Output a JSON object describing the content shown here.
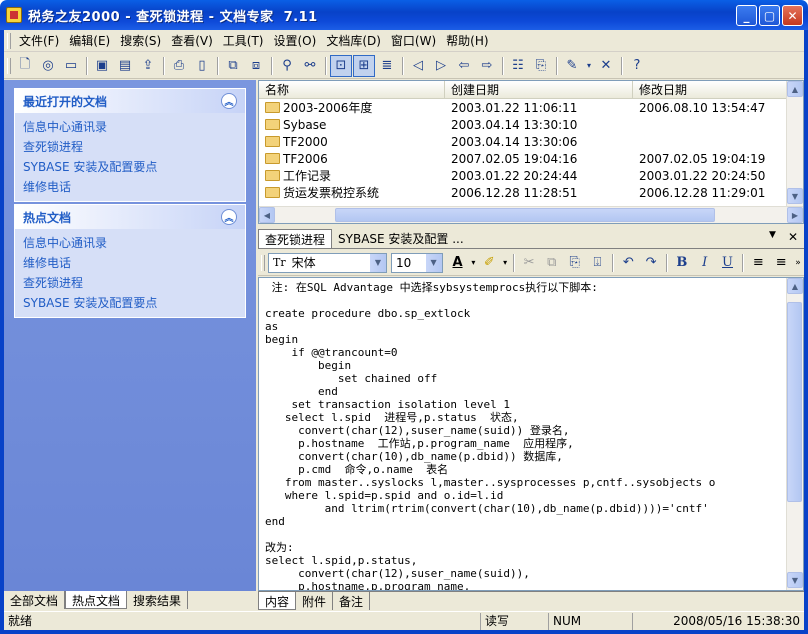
{
  "window": {
    "title": "税务之友2000 - 查死锁进程 - 文档专家  7.11"
  },
  "menu": [
    "文件(F)",
    "编辑(E)",
    "搜索(S)",
    "查看(V)",
    "工具(T)",
    "设置(O)",
    "文档库(D)",
    "窗口(W)",
    "帮助(H)"
  ],
  "toolbar": {
    "icons": [
      "new-doc",
      "open",
      "folder",
      "save",
      "save-all",
      "upload",
      "print",
      "print-preview",
      "copy-doc",
      "paste-doc",
      "find",
      "find-replace",
      "zoom-toggle",
      "zoom-fit",
      "export",
      "prev",
      "next",
      "back",
      "forward",
      "properties",
      "clipboard",
      "pen",
      "close-x",
      "help"
    ]
  },
  "sidebar": {
    "recent": {
      "title": "最近打开的文档",
      "items": [
        "信息中心通讯录",
        "查死锁进程",
        "SYBASE  安装及配置要点",
        "维修电话"
      ]
    },
    "hot": {
      "title": "热点文档",
      "items": [
        "信息中心通讯录",
        "维修电话",
        "查死锁进程",
        "SYBASE  安装及配置要点"
      ]
    },
    "tabs": [
      "全部文档",
      "热点文档",
      "搜索结果"
    ]
  },
  "filelist": {
    "columns": [
      "名称",
      "创建日期",
      "修改日期"
    ],
    "rows": [
      {
        "name": "2003-2006年度",
        "created": "2003.01.22 11:06:11",
        "modified": "2006.08.10 13:54:47"
      },
      {
        "name": "Sybase",
        "created": "2003.04.14 13:30:10",
        "modified": ""
      },
      {
        "name": "TF2000",
        "created": "2003.04.14 13:30:06",
        "modified": ""
      },
      {
        "name": "TF2006",
        "created": "2007.02.05 19:04:16",
        "modified": "2007.02.05 19:04:19"
      },
      {
        "name": "工作记录",
        "created": "2003.01.22 20:24:44",
        "modified": "2003.01.22 20:24:50"
      },
      {
        "name": "货运发票税控系统",
        "created": "2006.12.28 11:28:51",
        "modified": "2006.12.28 11:29:01"
      }
    ]
  },
  "doctabs": [
    "查死锁进程",
    "SYBASE  安装及配置 ..."
  ],
  "format": {
    "font": "宋体",
    "size": "10"
  },
  "editor": {
    "lines": [
      " 注: 在SQL Advantage 中选择sybsystemprocs执行以下脚本:",
      "",
      "create procedure dbo.sp_extlock",
      "as",
      "begin",
      "    if @@trancount=0",
      "        begin",
      "           set chained off",
      "        end",
      "    set transaction isolation level 1",
      "   select l.spid  进程号,p.status  状态,",
      "     convert(char(12),suser_name(suid)) 登录名,",
      "     p.hostname  工作站,p.program_name  应用程序,",
      "     convert(char(10),db_name(p.dbid)) 数据库,",
      "     p.cmd  命令,o.name  表名",
      "   from master..syslocks l,master..sysprocesses p,cntf..sysobjects o",
      "   where l.spid=p.spid and o.id=l.id",
      "         and ltrim(rtrim(convert(char(10),db_name(p.dbid))))='cntf'",
      "end",
      "",
      "改为:",
      "select l.spid,p.status,",
      "     convert(char(12),suser_name(suid)),",
      "     p.hostname,p.program_name,"
    ]
  },
  "bottomtabs": [
    "内容",
    "附件",
    "备注"
  ],
  "status": {
    "ready": "就绪",
    "mode": "读写",
    "num": "NUM",
    "datetime": "2008/05/16 15:38:30"
  }
}
